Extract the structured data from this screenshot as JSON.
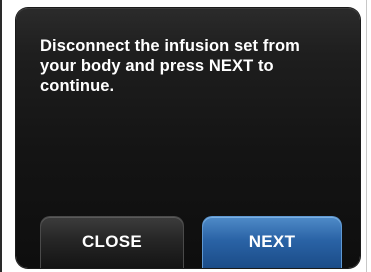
{
  "dialog": {
    "message": "Disconnect the infusion set from your body and press NEXT to continue."
  },
  "buttons": {
    "close_label": "CLOSE",
    "next_label": "NEXT"
  },
  "colors": {
    "screen_background": "#141414",
    "text": "#ffffff",
    "close_button": "#262626",
    "next_button_accent": "#2a63a6"
  }
}
